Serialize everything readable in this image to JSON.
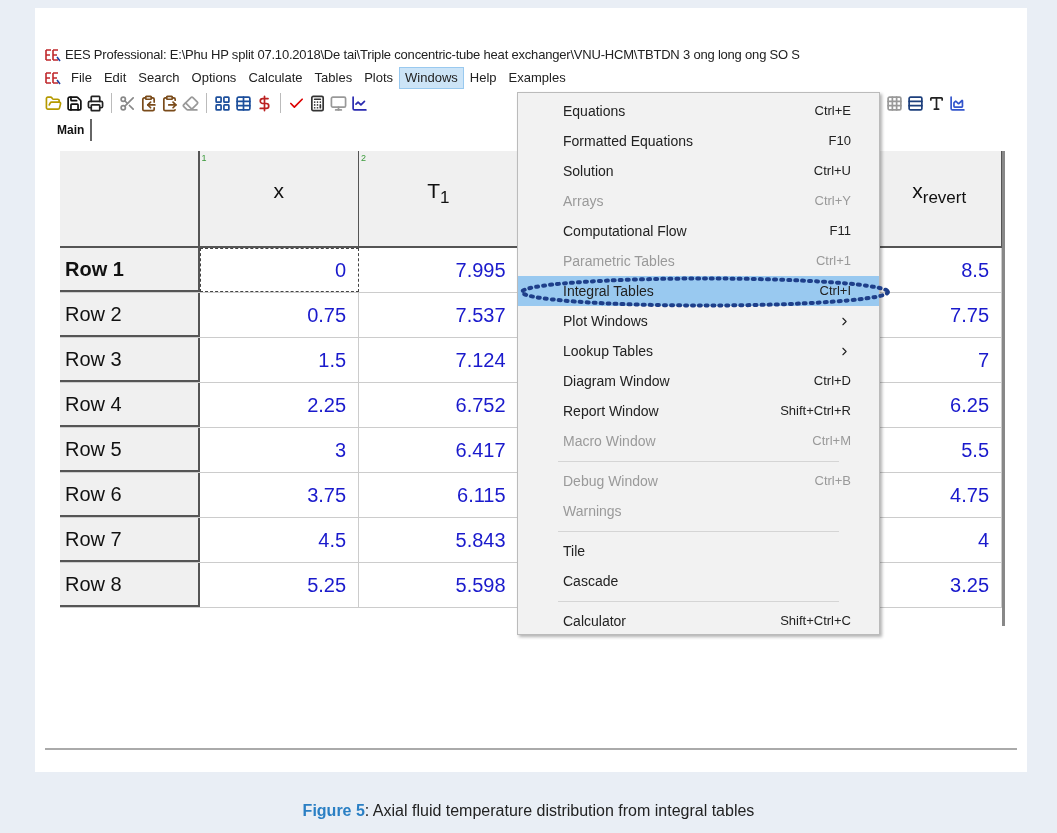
{
  "window": {
    "title": "EES Professional:  E:\\Phu HP split 07.10.2018\\De tai\\Triple concentric-tube heat exchanger\\VNU-HCM\\TBTDN 3 ong long ong SO S"
  },
  "menu_bar": [
    {
      "label": "File",
      "selected": false
    },
    {
      "label": "Edit",
      "selected": false
    },
    {
      "label": "Search",
      "selected": false
    },
    {
      "label": "Options",
      "selected": false
    },
    {
      "label": "Calculate",
      "selected": false
    },
    {
      "label": "Tables",
      "selected": false
    },
    {
      "label": "Plots",
      "selected": false
    },
    {
      "label": "Windows",
      "selected": true
    },
    {
      "label": "Help",
      "selected": false
    },
    {
      "label": "Examples",
      "selected": false
    }
  ],
  "tabs": [
    {
      "label": "Main",
      "selected": true
    }
  ],
  "table": {
    "columns": [
      {
        "index": "1",
        "label": "x"
      },
      {
        "index": "2",
        "label": "T$_{1}$"
      },
      {
        "kind": "hidden"
      },
      {
        "label": "x$_{revert}$"
      }
    ],
    "rows": [
      {
        "label": "Row 1",
        "selected": true,
        "cells": [
          "0",
          "7.995",
          "8.5"
        ]
      },
      {
        "label": "Row 2",
        "selected": false,
        "cells": [
          "0.75",
          "7.537",
          "7.75"
        ]
      },
      {
        "label": "Row 3",
        "selected": false,
        "cells": [
          "1.5",
          "7.124",
          "7"
        ]
      },
      {
        "label": "Row 4",
        "selected": false,
        "cells": [
          "2.25",
          "6.752",
          "6.25"
        ]
      },
      {
        "label": "Row 5",
        "selected": false,
        "cells": [
          "3",
          "6.417",
          "5.5"
        ]
      },
      {
        "label": "Row 6",
        "selected": false,
        "cells": [
          "3.75",
          "6.115",
          "4.75"
        ]
      },
      {
        "label": "Row 7",
        "selected": false,
        "cells": [
          "4.5",
          "5.843",
          "4"
        ]
      },
      {
        "label": "Row 8",
        "selected": false,
        "cells": [
          "5.25",
          "5.598",
          "3.25"
        ]
      }
    ]
  },
  "windows_menu": [
    {
      "kind": "item",
      "label": "Equations",
      "shortcut": "Ctrl+E",
      "disabled": false,
      "selected": false,
      "submenu": false
    },
    {
      "kind": "item",
      "label": "Formatted Equations",
      "shortcut": "F10",
      "disabled": false,
      "selected": false,
      "submenu": false
    },
    {
      "kind": "item",
      "label": "Solution",
      "shortcut": "Ctrl+U",
      "disabled": false,
      "selected": false,
      "submenu": false
    },
    {
      "kind": "item",
      "label": "Arrays",
      "shortcut": "Ctrl+Y",
      "disabled": true,
      "selected": false,
      "submenu": false
    },
    {
      "kind": "item",
      "label": "Computational Flow",
      "shortcut": "F11",
      "disabled": false,
      "selected": false,
      "submenu": false
    },
    {
      "kind": "item",
      "label": "Parametric Tables",
      "shortcut": "Ctrl+1",
      "disabled": true,
      "selected": false,
      "submenu": false
    },
    {
      "kind": "item",
      "label": "Integral Tables",
      "shortcut": "Ctrl+I",
      "disabled": false,
      "selected": true,
      "submenu": false
    },
    {
      "kind": "item",
      "label": "Plot Windows",
      "disabled": false,
      "selected": false,
      "submenu": true
    },
    {
      "kind": "item",
      "label": "Lookup Tables",
      "disabled": false,
      "selected": false,
      "submenu": true
    },
    {
      "kind": "item",
      "label": "Diagram Window",
      "shortcut": "Ctrl+D",
      "disabled": false,
      "selected": false,
      "submenu": false
    },
    {
      "kind": "item",
      "label": "Report Window",
      "shortcut": "Shift+Ctrl+R",
      "disabled": false,
      "selected": false,
      "submenu": false
    },
    {
      "kind": "item",
      "label": "Macro Window",
      "shortcut": "Ctrl+M",
      "disabled": true,
      "selected": false,
      "submenu": false
    },
    {
      "kind": "separator"
    },
    {
      "kind": "item",
      "label": "Debug Window",
      "shortcut": "Ctrl+B",
      "disabled": true,
      "selected": false,
      "submenu": false
    },
    {
      "kind": "item",
      "label": "Warnings",
      "disabled": true,
      "selected": false,
      "submenu": false
    },
    {
      "kind": "separator"
    },
    {
      "kind": "item",
      "label": "Tile",
      "disabled": false,
      "selected": false,
      "submenu": false
    },
    {
      "kind": "item",
      "label": "Cascade",
      "disabled": false,
      "selected": false,
      "submenu": false
    },
    {
      "kind": "separator"
    },
    {
      "kind": "item",
      "label": "Calculator",
      "shortcut": "Shift+Ctrl+C",
      "disabled": false,
      "selected": false,
      "submenu": false
    }
  ],
  "caption": {
    "label": "Figure 5",
    "text": ": Axial fluid temperature distribution from integral tables"
  }
}
